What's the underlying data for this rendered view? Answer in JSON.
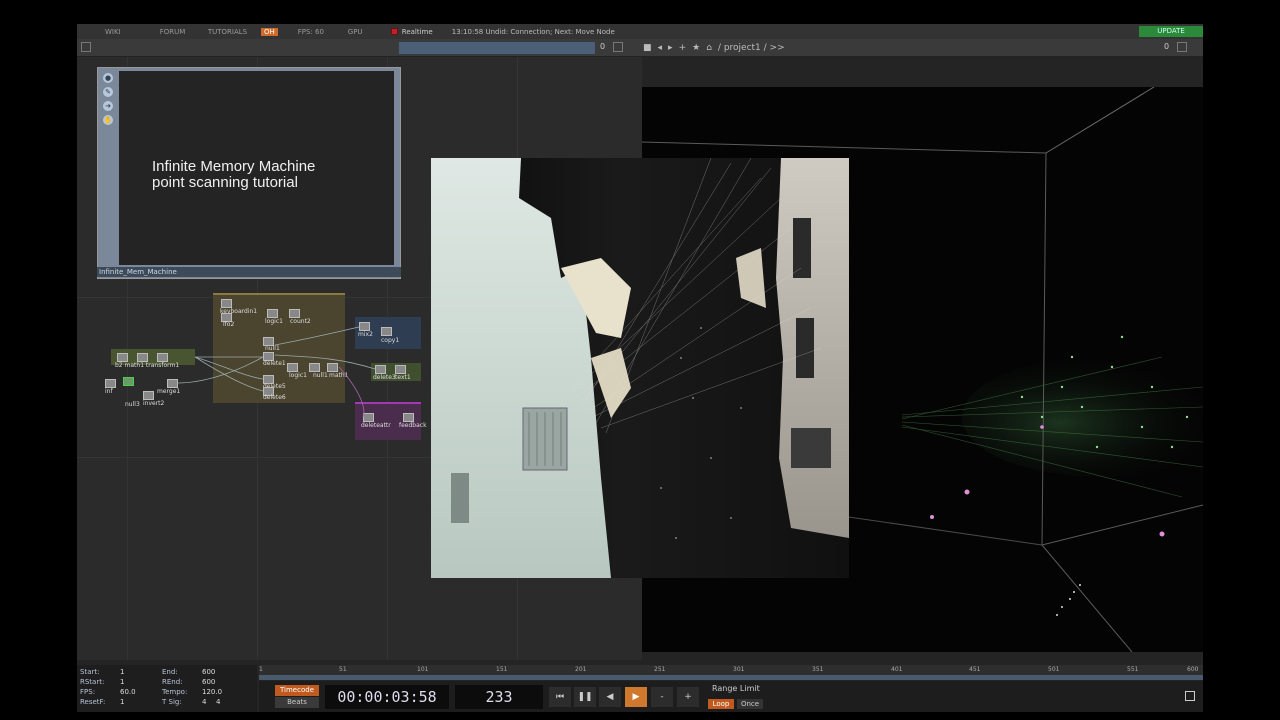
{
  "topbar": {
    "menu_wiki": "WIKI",
    "menu_forum": "FORUM",
    "menu_tutorials": "TUTORIALS",
    "badge": "OH",
    "fps": "FPS: 60",
    "gpu": "GPU",
    "realtime": "Realtime",
    "status": "13:10:58 Undid: Connection; Next: Move Node",
    "update": "UPDATE"
  },
  "toolbar": {
    "num_left": "0",
    "num_right": "0",
    "path": "/ project1 / >>"
  },
  "comp": {
    "title_line1": "Infinite Memory Machine",
    "title_line2": "point scanning tutorial",
    "label": "Infinite_Mem_Machine"
  },
  "nodes": {
    "n1": "keyboardin1",
    "n2": "logic1",
    "n3": "count2",
    "n4": "lfo2",
    "n5": "null1",
    "n6": "delete1",
    "n7": "delete5",
    "n8": "delete6",
    "n9": "logic1",
    "n10": "null1",
    "n11": "math1",
    "n12": "delete3",
    "n13": "text1",
    "n14": "copy1",
    "n15": "math2",
    "n16": "merge1",
    "n17": "invert2",
    "n18": "null3",
    "n19": "deleteattr",
    "n20": "feedback",
    "n21": "b2 math1 transform1",
    "n22": "inf",
    "n23": "mix2"
  },
  "params": {
    "start_k": "Start:",
    "start_v": "1",
    "end_k": "End:",
    "end_v": "600",
    "rstart_k": "RStart:",
    "rstart_v": "1",
    "rend_k": "REnd:",
    "rend_v": "600",
    "fps_k": "FPS:",
    "fps_v": "60.0",
    "tempo_k": "Tempo:",
    "tempo_v": "120.0",
    "resetf_k": "ResetF:",
    "resetf_v": "1",
    "tsig_k": "T Sig:",
    "tsig_v1": "4",
    "tsig_v2": "4"
  },
  "timeline": {
    "ticks": [
      "1",
      "51",
      "101",
      "151",
      "201",
      "251",
      "301",
      "351",
      "401",
      "451",
      "501",
      "551",
      "600"
    ],
    "timecode_label": "Timecode",
    "beats_label": "Beats",
    "timecode": "00:00:03:58",
    "frame": "233",
    "range_limit": "Range Limit",
    "loop": "Loop",
    "once": "Once",
    "minus": "-",
    "plus": "+"
  }
}
